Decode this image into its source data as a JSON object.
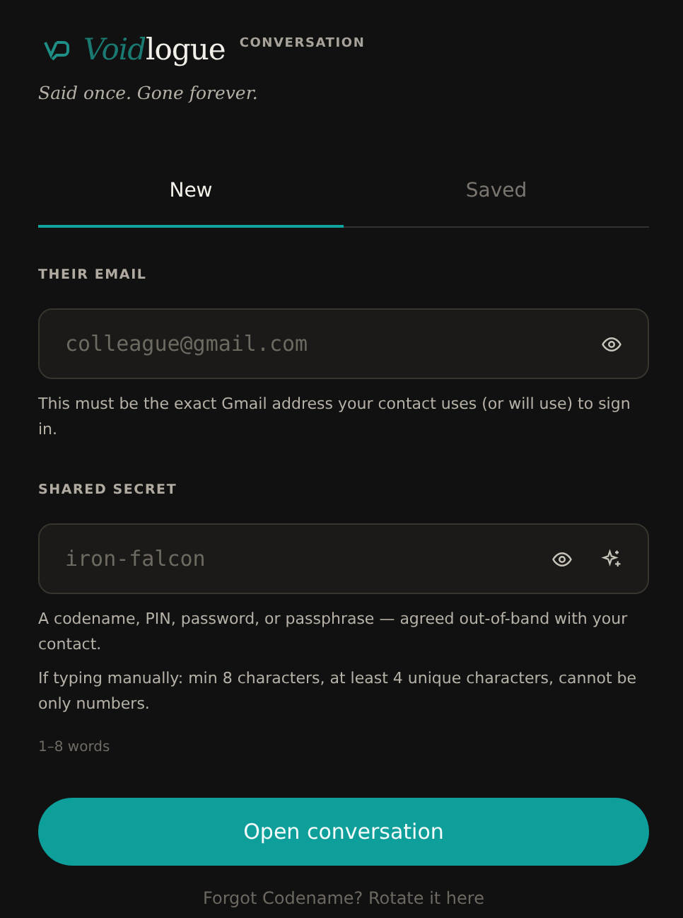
{
  "brand": {
    "accent": "Void",
    "rest": "logue",
    "section": "CONVERSATION"
  },
  "tagline": "Said once. Gone forever.",
  "tabs": [
    {
      "label": "New",
      "selected": true
    },
    {
      "label": "Saved",
      "selected": false
    }
  ],
  "fields": [
    {
      "label": "THEIR EMAIL",
      "placeholder": "colleague@gmail.com",
      "generate": false,
      "hints": [
        "This must be the exact Gmail address your contact uses (or will use) to sign in."
      ]
    },
    {
      "label": "SHARED SECRET",
      "placeholder": "iron-falcon",
      "generate": true,
      "hints": [
        "A codename, PIN, password, or passphrase — agreed out-of-band with your contact.",
        "If typing manually: min 8 characters, at least 4 unique characters, cannot be only numbers."
      ],
      "note": "1–8 words"
    }
  ],
  "submit": "Open conversation",
  "footer_link": "Forgot Codename? Rotate it here"
}
